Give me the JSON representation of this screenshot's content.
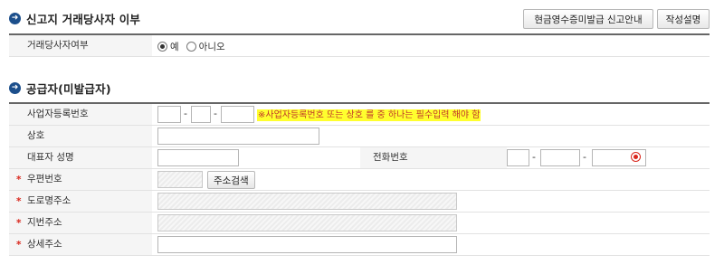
{
  "section1": {
    "title": "신고지 거래당사자 이부",
    "buttons": {
      "guide": "현금영수증미발급 신고안내",
      "howto": "작성설명"
    },
    "row": {
      "label": "거래당사자여부",
      "option_yes": "예",
      "option_no": "아니오",
      "selected": "yes"
    }
  },
  "section2": {
    "title": "공급자(미발급자)",
    "rows": {
      "bizno": {
        "label": "사업자등록번호",
        "dash": "-",
        "notice": "※사업자등록번호 또는 상호 를 중 하나는 필수입력 해야 함"
      },
      "name": {
        "label": "상호"
      },
      "rep": {
        "label": "대표자 성명"
      },
      "phone": {
        "label": "전화번호",
        "dash": "-"
      },
      "zip": {
        "label": "우편번호",
        "search_button": "주소검색"
      },
      "road": {
        "label": "도로명주소"
      },
      "lot": {
        "label": "지번주소"
      },
      "detail": {
        "label": "상세주소"
      }
    }
  }
}
